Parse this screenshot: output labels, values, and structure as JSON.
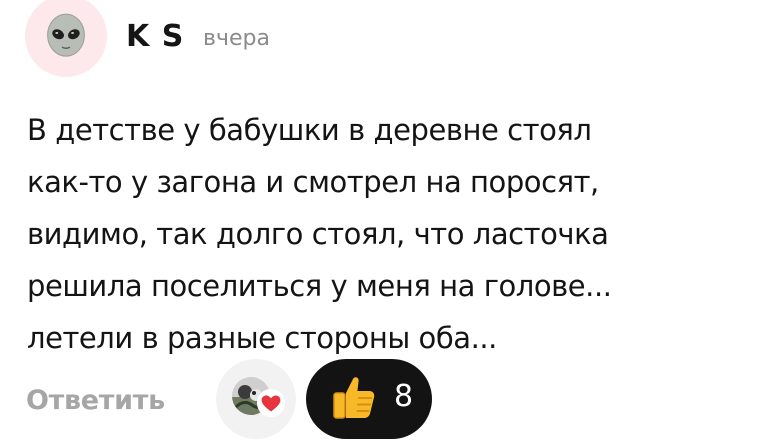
{
  "comment": {
    "author": "K S",
    "time": "вчера",
    "avatar_icon": "alien-face-icon",
    "text_lines": [
      "В детстве у бабушки в деревне стоял",
      "как-то у загона и смотрел на поросят,",
      "видимо, так долго стоял, что ласточка",
      "решила поселиться у меня на голове...",
      "летели в разные стороны оба..."
    ]
  },
  "actions": {
    "reply_label": "Ответить",
    "reactions": [
      {
        "icon": "heart-icon",
        "avatar_icon": "user-photo-icon"
      },
      {
        "icon": "thumbs-up-icon",
        "count": "8"
      }
    ]
  },
  "colors": {
    "avatar_bg": "#fde9ec",
    "secondary_text": "#8b8b8b",
    "reply": "#a6a6a6",
    "like_pill": "#131313",
    "heart": "#e8343f",
    "thumb": "#f7b928"
  }
}
